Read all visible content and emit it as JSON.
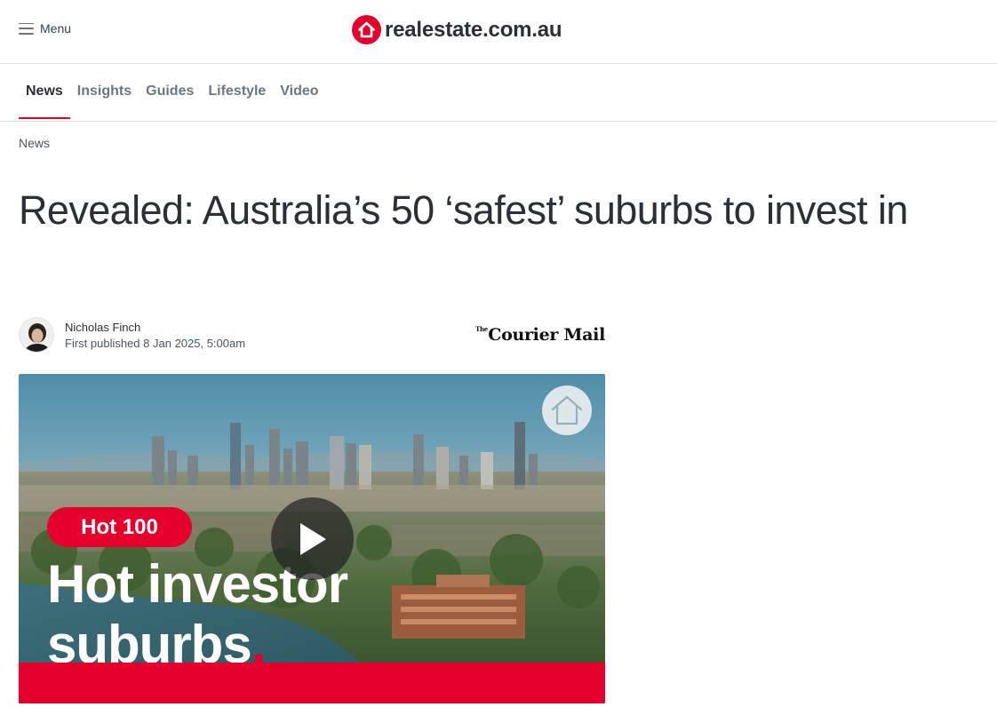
{
  "header": {
    "menu_label": "Menu",
    "brand": "realestate.com.au",
    "brand_color": "#e4002b"
  },
  "nav": {
    "tabs": [
      {
        "label": "News",
        "active": true
      },
      {
        "label": "Insights",
        "active": false
      },
      {
        "label": "Guides",
        "active": false
      },
      {
        "label": "Lifestyle",
        "active": false
      },
      {
        "label": "Video",
        "active": false
      }
    ]
  },
  "breadcrumb": "News",
  "article": {
    "headline": "Revealed: Australia’s 50 ‘safest’ suburbs to invest in",
    "author": "Nicholas Finch",
    "published": "First published 8 Jan 2025, 5:00am",
    "publisher": {
      "small": "The",
      "name": "Courier Mail"
    }
  },
  "video": {
    "tag": "Hot 100",
    "title_line1": "Hot investor",
    "title_line2": "suburbs",
    "title_dot": ".",
    "icons": {
      "badge": "house-outline-icon",
      "play": "play-icon"
    }
  }
}
